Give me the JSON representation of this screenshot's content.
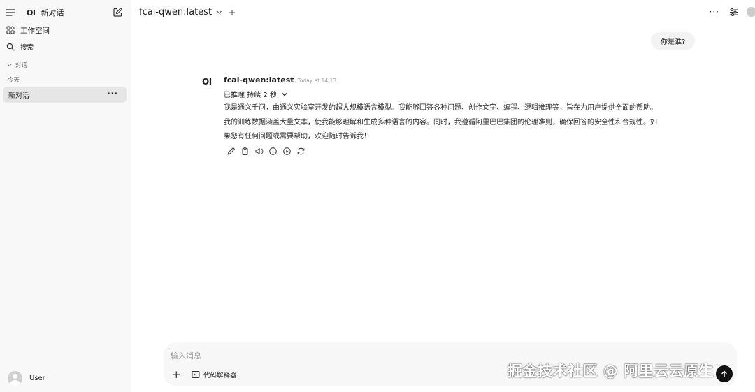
{
  "sidebar": {
    "logo": "OI",
    "new_chat_label": "新对话",
    "workspace_label": "工作空间",
    "search_label": "搜索",
    "section_label": "对话",
    "today_label": "今天",
    "chats": [
      {
        "title": "新对话",
        "more": "···"
      }
    ],
    "user_name": "User"
  },
  "header": {
    "model_title": "fcai-qwen:latest",
    "add": "+",
    "more": "···"
  },
  "conversation": {
    "user_message": "你是谁?",
    "assistant": {
      "logo": "OI",
      "model_name": "fcai-qwen:latest",
      "timestamp": "Today at 14:13",
      "reasoning_label": "已推理 持续 2 秒",
      "lines": [
        "我是通义千问，由通义实验室开发的超大规模语言模型。我能够回答各种问题、创作文字、编程、逻辑推理等，旨在为用户提供全面的帮助。",
        "我的训练数据涵盖大量文本，使我能够理解和生成多种语言的内容。同时，我遵循阿里巴巴集团的伦理准则，确保回答的安全性和合规性。如",
        "果您有任何问题或需要帮助，欢迎随时告诉我！"
      ]
    }
  },
  "input": {
    "placeholder": "输入消息",
    "add": "+",
    "code_interpreter_label": "代码解释器"
  },
  "watermark": "掘金技术社区 @ 阿里云云原生"
}
